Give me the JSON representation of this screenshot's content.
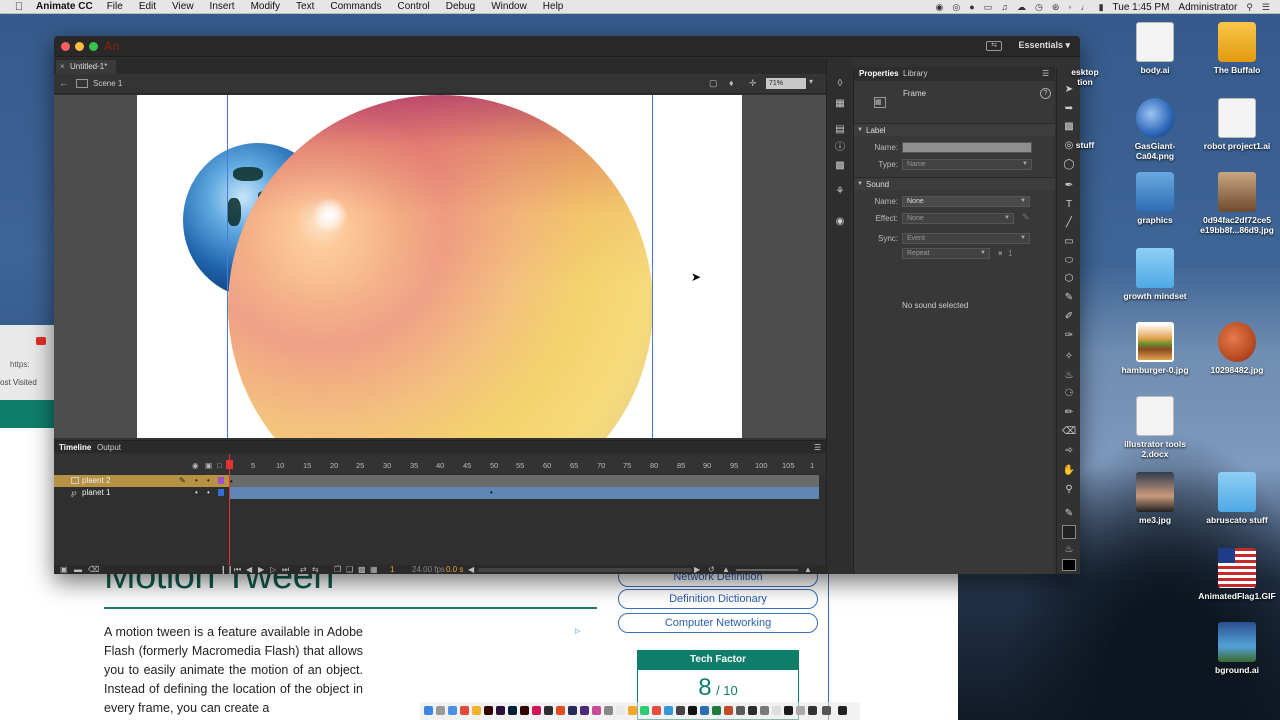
{
  "menubar": {
    "app_name": "Animate CC",
    "menus": [
      "File",
      "Edit",
      "View",
      "Insert",
      "Modify",
      "Text",
      "Commands",
      "Control",
      "Debug",
      "Window",
      "Help"
    ],
    "clock": "Tue 1:45 PM",
    "user": "Administrator"
  },
  "browser": {
    "url_fragment": "https:",
    "bookmark_label": "ost Visited",
    "article_title": "Motion Tween",
    "article_body": "A motion tween is a feature available in Adobe Flash (formerly Macromedia Flash) that allows you to easily animate the motion of an object. Instead of defining the location of the object in every frame, you can create a",
    "sidebar_links": [
      "Network Definition",
      "Definition Dictionary",
      "Computer Networking"
    ],
    "tech_factor_label": "Tech Factor",
    "tech_factor_score": "8",
    "tech_factor_outof": "/ 10"
  },
  "animate": {
    "logo": "An",
    "workspace": "Essentials",
    "doc_tab": "Untitled-1*",
    "scene": "Scene 1",
    "zoom": "71%",
    "panel_tabs": [
      "Properties",
      "Library"
    ],
    "frame_title": "Frame",
    "label_section": "Label",
    "label_name": "Name:",
    "label_type": "Type:",
    "label_type_value": "Name",
    "sound_section": "Sound",
    "sound_name": "Name:",
    "sound_name_value": "None",
    "sound_effect": "Effect:",
    "sound_effect_value": "None",
    "sound_sync": "Sync:",
    "sound_sync_value": "Event",
    "sound_repeat_value": "Repeat",
    "sound_repeat_count": "1",
    "no_sound": "No sound selected",
    "timeline_tabs": [
      "Timeline",
      "Output"
    ],
    "frame_numbers": [
      "1",
      "5",
      "10",
      "15",
      "20",
      "25",
      "30",
      "35",
      "40",
      "45",
      "50",
      "55",
      "60",
      "65",
      "70",
      "75",
      "80",
      "85",
      "90",
      "95",
      "100",
      "105",
      "1"
    ],
    "layers": [
      {
        "name": "plaent 2",
        "selected": true
      },
      {
        "name": "planet 1",
        "selected": false
      }
    ],
    "footer_frame": "1",
    "footer_fps": "24.00 fps",
    "footer_time": "0.0 s"
  },
  "desktop_icons": [
    {
      "label": "body.ai"
    },
    {
      "label": "The Buffalo"
    },
    {
      "label": "esktop\ntion"
    },
    {
      "label": "GasGiant-\nCa04.png"
    },
    {
      "label": "robot project1.ai"
    },
    {
      "label": "stuff"
    },
    {
      "label": "graphics"
    },
    {
      "label": "0d94fac2df72ce5\ne19bb8f...86d9.jpg"
    },
    {
      "label": "growth mindset"
    },
    {
      "label": "hamburger-0.jpg"
    },
    {
      "label": "10298482.jpg"
    },
    {
      "label": "illustrator tools\n2.docx"
    },
    {
      "label": "me3.jpg"
    },
    {
      "label": "abruscato stuff"
    },
    {
      "label": "AnimatedFlag1.GIF"
    },
    {
      "label": "bground.ai"
    }
  ],
  "colors": {
    "accent_teal": "#0e7e6b",
    "layer_selected": "#c8a04a",
    "tween_span": "#5f86b5",
    "playhead": "#e23232"
  }
}
